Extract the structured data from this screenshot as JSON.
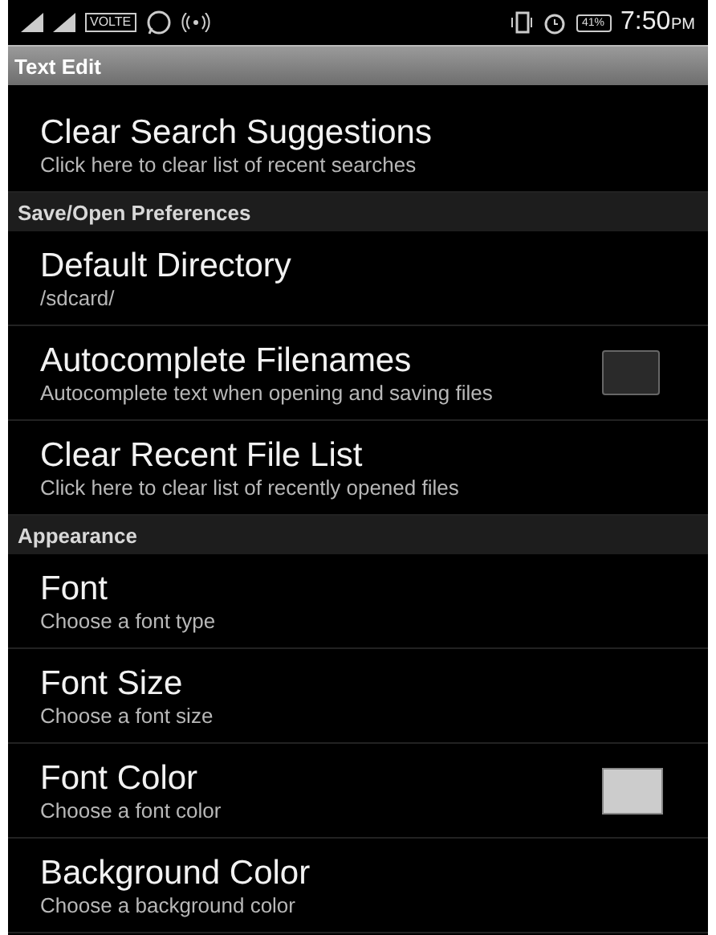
{
  "status_bar": {
    "volte": "VOLTE",
    "battery": "41%",
    "time": "7:50",
    "meridiem": "PM"
  },
  "title_bar": {
    "title": "Text Edit"
  },
  "sections": [
    {
      "items": [
        {
          "kind": "text",
          "title": "Clear Search Suggestions",
          "summary": "Click here to clear list of recent searches"
        }
      ]
    },
    {
      "header": "Save/Open Preferences",
      "items": [
        {
          "kind": "text",
          "title": "Default Directory",
          "summary": "/sdcard/"
        },
        {
          "kind": "checkbox",
          "title": "Autocomplete Filenames",
          "summary": "Autocomplete text when opening and saving files",
          "checked": false
        },
        {
          "kind": "text",
          "title": "Clear Recent File List",
          "summary": "Click here to clear list of recently opened files"
        }
      ]
    },
    {
      "header": "Appearance",
      "items": [
        {
          "kind": "text",
          "title": "Font",
          "summary": "Choose a font type"
        },
        {
          "kind": "text",
          "title": "Font Size",
          "summary": "Choose a font size"
        },
        {
          "kind": "color",
          "title": "Font Color",
          "summary": "Choose a font color",
          "color": "#cccccc"
        },
        {
          "kind": "text",
          "title": "Background Color",
          "summary": "Choose a background color"
        }
      ]
    }
  ]
}
